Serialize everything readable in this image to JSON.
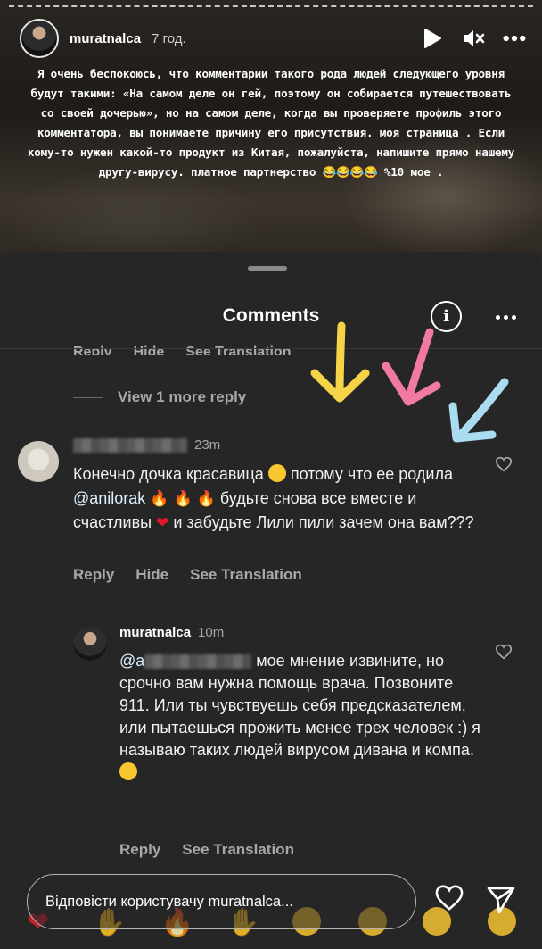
{
  "story": {
    "username": "muratnalca",
    "time": "7 год.",
    "text": "Я очень беспокоюсь, что комментарии такого рода людей следующего уровня будут такими: «На самом деле он гей, поэтому он собирается путешествовать со своей дочерью», но на самом деле, когда вы проверяете профиль этого комментатора, вы понимаете причину его присутствия.  моя страница .  Если кому-то нужен какой-то продукт из Китая, пожалуйста, напишите прямо нашему другу-вирусу. платное партнерство 😂😂😂😂 %10 мое ."
  },
  "sheet": {
    "title": "Comments",
    "cut_actions": [
      "Reply",
      "Hide",
      "See Translation"
    ],
    "view_more_replies": "View 1 more reply"
  },
  "comments": [
    {
      "time": "23m",
      "text_parts": {
        "a": "Конечно дочка красавица",
        "b": " потому что ее родила ",
        "mention": "@anilorak",
        "c": " будьте снова все вместе и счастливы ",
        "d": " и забудьте Лили пили зачем она вам???"
      },
      "actions": [
        "Reply",
        "Hide",
        "See Translation"
      ]
    },
    {
      "username": "muratnalca",
      "time": "10m",
      "mention_prefix": "@a",
      "text": " мое мнение извините, но срочно вам нужна помощь врача. Позвоните 911. Или ты чувствуешь себя предсказателем, или пытаешься прожить менее трех человек :) я называю таких людей вирусом дивана и компа.",
      "actions": [
        "Reply",
        "See Translation"
      ]
    }
  ],
  "reply_bar": {
    "placeholder": "Відповісти користувачу muratnalca..."
  },
  "icons": {
    "play": "play-icon",
    "mute": "mute-icon",
    "more": "more-icon",
    "info": "info-icon",
    "like": "heart-icon",
    "send": "send-icon"
  },
  "colors": {
    "sheet_bg": "#262626",
    "secondary_text": "#a8a8a8",
    "arrow_yellow": "#f5d547",
    "arrow_pink": "#f07aa0",
    "arrow_blue": "#a9dcef"
  }
}
